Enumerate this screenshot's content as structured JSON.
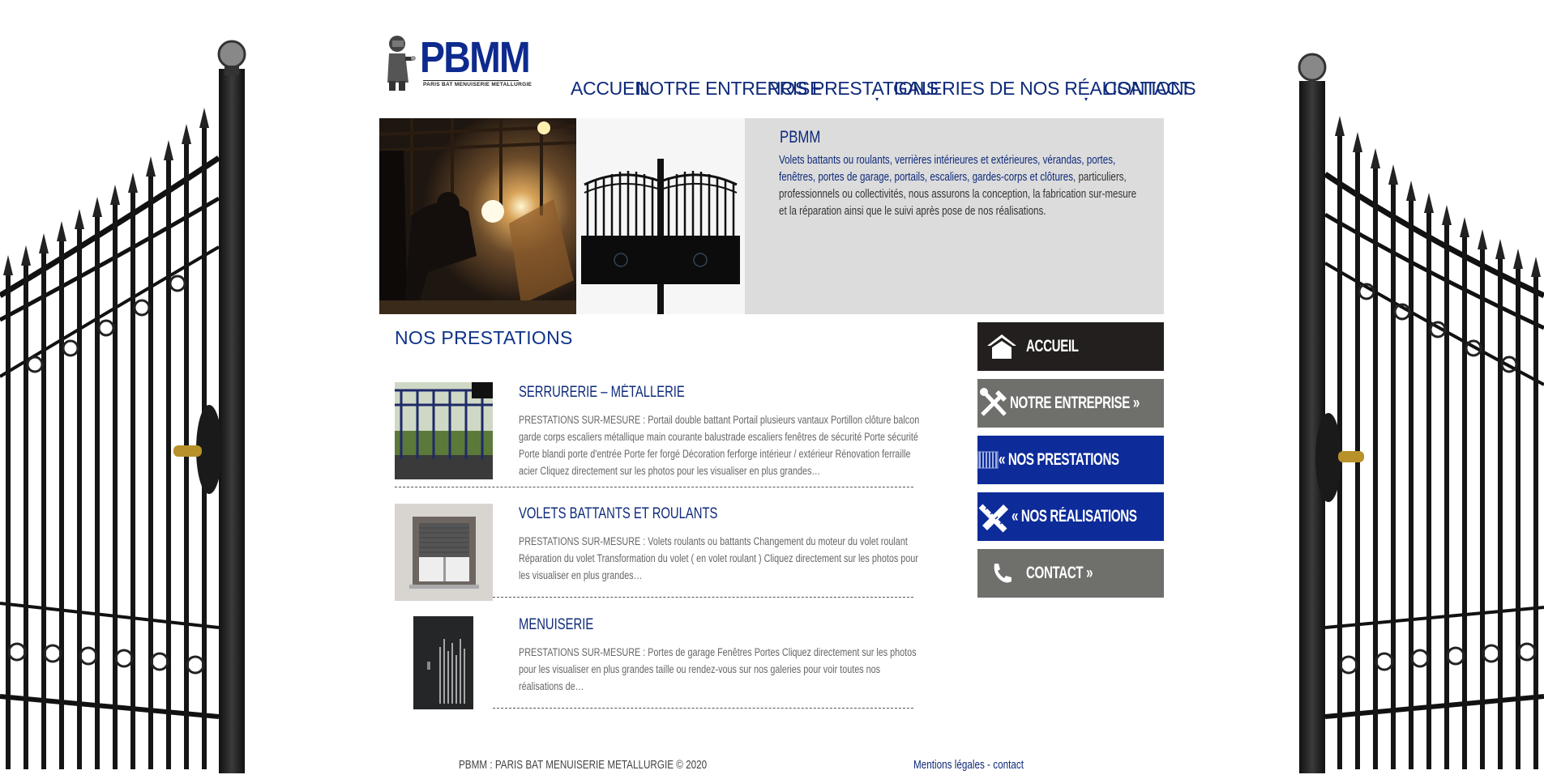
{
  "logo": {
    "text": "PBMM",
    "subtitle": "PARIS BAT MENUISERIE METALLURGIE"
  },
  "nav": [
    {
      "label": "ACCUEIL",
      "has_dropdown": false
    },
    {
      "label": "NOTRE ENTREPRISE",
      "has_dropdown": false
    },
    {
      "label": "NOS PRESTATIONS",
      "has_dropdown": true
    },
    {
      "label": "GALERIES DE NOS RÉALISATIONS",
      "has_dropdown": true
    },
    {
      "label": "CONTACT",
      "has_dropdown": false
    }
  ],
  "banner": {
    "title": "PBMM",
    "text_highlight": "Volets battants ou roulants, verrières intérieures et extérieures, vérandas, portes, fenêtres, portes de garage, portails, escaliers, gardes-corps et clôtures",
    "text_rest": ", particuliers, professionnels ou collectivités, nous assurons la conception, la fabrication sur-mesure et la réparation ainsi que le suivi après pose de nos réalisations."
  },
  "main": {
    "section_title": "NOS PRESTATIONS",
    "services": [
      {
        "title": "SERRURERIE – MÉTALLERIE",
        "description": "PRESTATIONS SUR-MESURE :   Portail double battant Portail plusieurs vantaux Portillon clôture balcon garde corps escaliers métallique main courante balustrade escaliers fenêtres de sécurité Porte sécurité Porte blandi porte d'entrée Porte fer forgé Décoration ferforge intérieur / extérieur Rénovation ferraille acier Cliquez directement sur les photos pour les visualiser en plus grandes…"
      },
      {
        "title": "VOLETS BATTANTS ET ROULANTS",
        "description": "PRESTATIONS SUR-MESURE :   Volets roulants ou battants Changement du moteur du volet roulant Réparation du volet Transformation du volet ( en volet roulant ) Cliquez directement sur les photos pour les visualiser en plus grandes…"
      },
      {
        "title": "MENUISERIE",
        "description": "PRESTATIONS SUR-MESURE :   Portes de garage Fenêtres Portes   Cliquez directement sur les photos pour les visualiser en plus grandes taille ou rendez-vous sur nos galeries pour voir toutes nos réalisations de…"
      }
    ]
  },
  "sidebar": [
    {
      "label": "ACCUEIL",
      "icon": "home-icon",
      "color": "#231f1e"
    },
    {
      "label": "NOTRE ENTREPRISE »",
      "icon": "tools-icon",
      "color": "#6f6f6c"
    },
    {
      "label": "« NOS PRESTATIONS",
      "icon": "barcode-icon",
      "color": "#0d2b99"
    },
    {
      "label": "« NOS RÉALISATIONS",
      "icon": "pencil-ruler-icon",
      "color": "#0d2b99"
    },
    {
      "label": "CONTACT »",
      "icon": "phone-icon",
      "color": "#6f6f6c"
    }
  ],
  "footer": {
    "copyright": "PBMM : PARIS BAT MENUISERIE METALLURGIE © 2020",
    "legal": "Mentions légales",
    "separator": " - ",
    "contact": "contact"
  },
  "colors": {
    "brand_blue": "#0e2a7a",
    "accent_blue": "#0d2b99",
    "banner_grey": "#dcdcdc"
  }
}
